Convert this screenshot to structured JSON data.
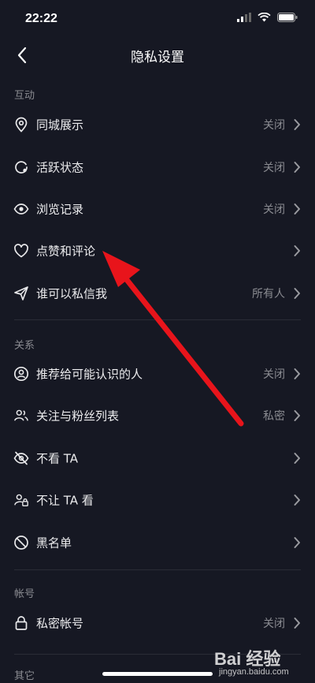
{
  "status_bar": {
    "time": "22:22"
  },
  "header": {
    "title": "隐私设置"
  },
  "sections": [
    {
      "header": "互动",
      "items": [
        {
          "label": "同城展示",
          "value": "关闭",
          "icon": "location-pin-icon"
        },
        {
          "label": "活跃状态",
          "value": "关闭",
          "icon": "activity-status-icon"
        },
        {
          "label": "浏览记录",
          "value": "关闭",
          "icon": "eye-icon"
        },
        {
          "label": "点赞和评论",
          "value": "",
          "icon": "heart-icon"
        },
        {
          "label": "谁可以私信我",
          "value": "所有人",
          "icon": "send-icon"
        }
      ]
    },
    {
      "header": "关系",
      "items": [
        {
          "label": "推荐给可能认识的人",
          "value": "关闭",
          "icon": "user-circle-icon"
        },
        {
          "label": "关注与粉丝列表",
          "value": "私密",
          "icon": "users-icon"
        },
        {
          "label": "不看 TA",
          "value": "",
          "icon": "eye-off-icon"
        },
        {
          "label": "不让 TA 看",
          "value": "",
          "icon": "user-lock-icon"
        },
        {
          "label": "黑名单",
          "value": "",
          "icon": "block-icon"
        }
      ]
    },
    {
      "header": "帐号",
      "items": [
        {
          "label": "私密帐号",
          "value": "关闭",
          "icon": "lock-icon"
        }
      ]
    },
    {
      "header": "其它",
      "items": []
    }
  ],
  "watermark": {
    "brand": "Bai 经验",
    "url": "jingyan.baidu.com"
  },
  "colors": {
    "background": "#161823",
    "annotation_arrow": "#e8141b"
  }
}
